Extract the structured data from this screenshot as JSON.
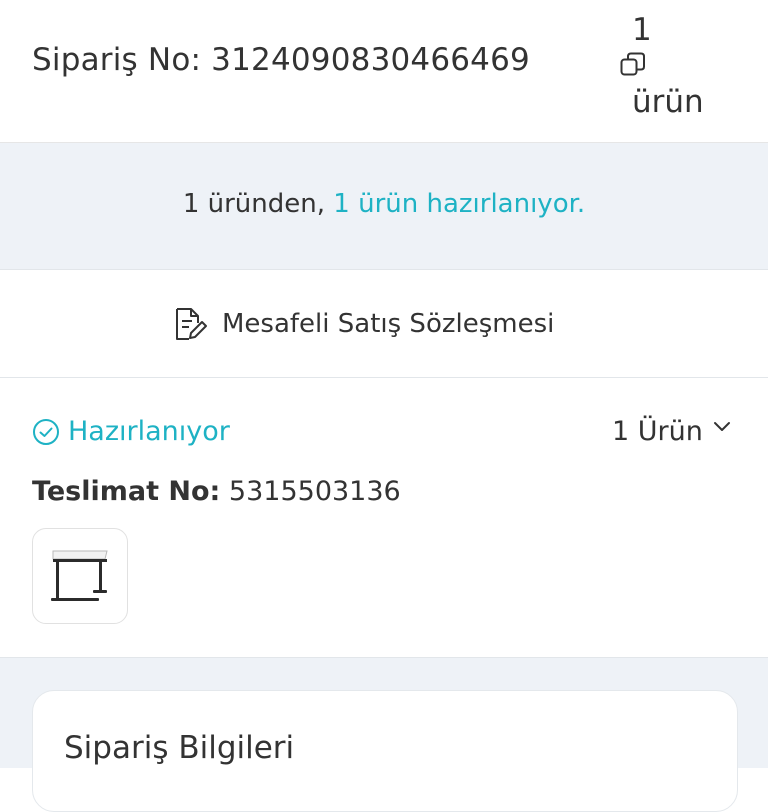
{
  "colors": {
    "accent": "#1eb2c4",
    "text": "#333333",
    "band_background": "#eef2f7",
    "border": "#e2e6ea"
  },
  "header": {
    "order_label": "Sipariş No: 3124090830466469",
    "copy_icon": "copy-icon",
    "item_count": "1",
    "item_unit": "ürün"
  },
  "status_summary": {
    "prefix": "1 üründen, ",
    "accent": "1 ürün hazırlanıyor."
  },
  "contract": {
    "icon": "document-edit-icon",
    "label": "Mesafeli Satış Sözleşmesi"
  },
  "shipment": {
    "status_icon": "check-circle-icon",
    "status_label": "Hazırlanıyor",
    "items_label": "1 Ürün",
    "toggle_icon": "chevron-down-icon",
    "delivery_label": "Teslimat No:",
    "delivery_number": "5315503136",
    "product_image": "side-table-product-image"
  },
  "order_info": {
    "title": "Sipariş Bilgileri"
  }
}
